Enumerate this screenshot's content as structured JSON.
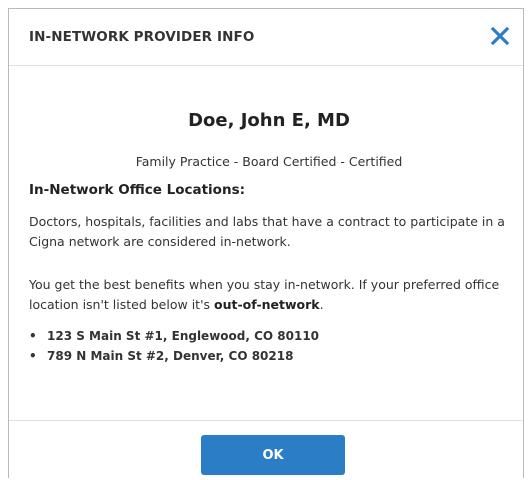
{
  "dialog": {
    "title": "IN-NETWORK PROVIDER INFO",
    "close_icon": "close-icon",
    "close_color": "#2b7ec6"
  },
  "provider": {
    "name": "Doe, John E, MD",
    "specialty": "Family Practice - Board Certified - Certified"
  },
  "locations_section": {
    "title": "In-Network Office Locations:",
    "paragraph1": "Doctors, hospitals, facilities and labs that have a contract to participate in a Cigna network are considered in-network.",
    "paragraph2_text": "You get the best benefits when you stay in-network. If your preferred office location isn't listed below it's ",
    "paragraph2_emphasis": "out-of-network",
    "paragraph2_end": ".",
    "bullet": "•",
    "items": [
      "123 S Main St #1, Englewood, CO 80110",
      "789 N Main St #2, Denver, CO 80218"
    ]
  },
  "footer": {
    "ok_label": "OK",
    "ok_color": "#2b7ec6"
  }
}
